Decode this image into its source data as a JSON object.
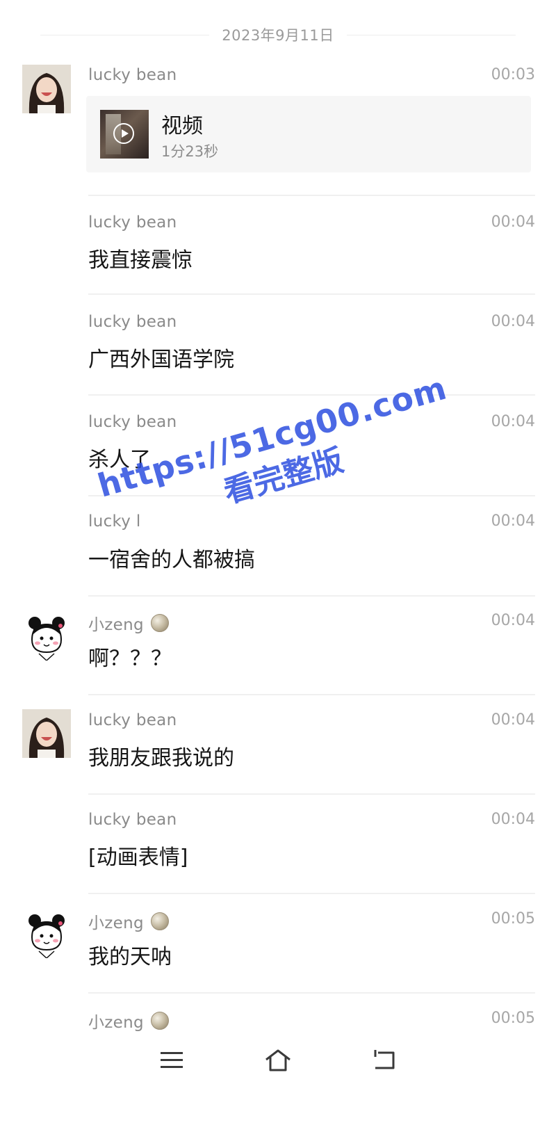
{
  "date_divider": "2023年9月11日",
  "messages": [
    {
      "sender": "lucky  bean",
      "time": "00:03",
      "type": "video",
      "video": {
        "title": "视频",
        "duration": "1分23秒"
      }
    },
    {
      "sender": "lucky  bean",
      "time": "00:04",
      "text": "我直接震惊"
    },
    {
      "sender": "lucky  bean",
      "time": "00:04",
      "text": "广西外国语学院"
    },
    {
      "sender": "lucky  bean",
      "time": "00:04",
      "text": "杀人了"
    },
    {
      "sender": "lucky  l",
      "time": "00:04",
      "text": "一宿舍的人都被搞"
    },
    {
      "sender": "小zeng",
      "time": "00:04",
      "text": "啊？？？"
    },
    {
      "sender": "lucky  bean",
      "time": "00:04",
      "text": "我朋友跟我说的"
    },
    {
      "sender": "lucky  bean",
      "time": "00:04",
      "text": "[动画表情]"
    },
    {
      "sender": "小zeng",
      "time": "00:05",
      "text": "我的天呐"
    },
    {
      "sender": "小zeng",
      "time": "00:05"
    }
  ],
  "watermark": {
    "url": "https://51cg00.com",
    "subtitle": "看完整版"
  },
  "navbar": {
    "icons": [
      "menu-icon",
      "home-icon",
      "back-icon"
    ]
  }
}
